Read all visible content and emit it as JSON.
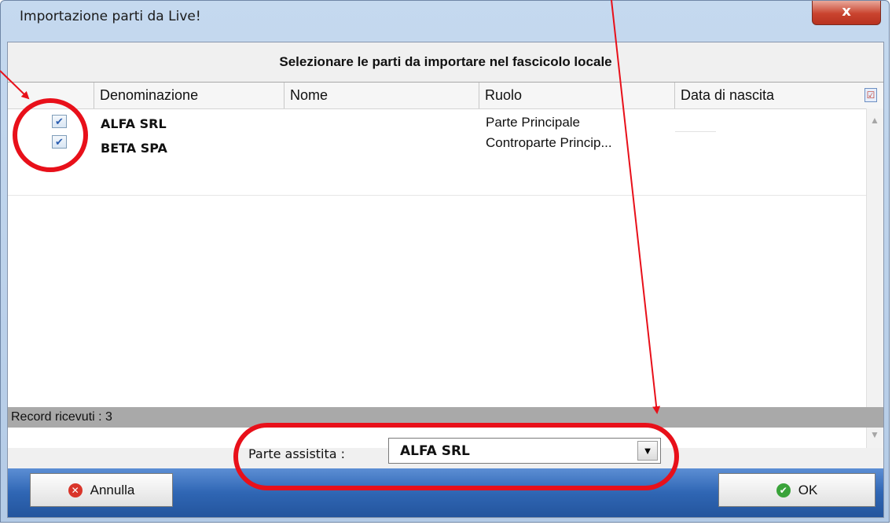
{
  "window": {
    "title": "Importazione parti da Live!",
    "close_glyph": "x"
  },
  "header": {
    "title": "Selezionare le parti da importare nel fascicolo locale"
  },
  "grid": {
    "columns": [
      "Denominazione",
      "Nome",
      "Ruolo",
      "Data di nascita"
    ],
    "rows": [
      {
        "checked": true,
        "denominazione": "ALFA SRL",
        "nome": "",
        "ruolo": "Parte Principale",
        "data_di_nascita": ""
      },
      {
        "checked": true,
        "denominazione": "BETA SPA",
        "nome": "",
        "ruolo": "Controparte Princip...",
        "data_di_nascita": ""
      }
    ],
    "check_glyph": "✔",
    "column_chooser_icon": "column-chooser-icon",
    "scroll_up_glyph": "▲",
    "scroll_down_glyph": "▼"
  },
  "status": {
    "text": "Record ricevuti : 3"
  },
  "parte_assistita": {
    "label": "Parte assistita :",
    "value": "ALFA SRL",
    "dropdown_glyph": "▼"
  },
  "buttons": {
    "cancel": {
      "label": "Annulla",
      "icon": "cancel-icon",
      "glyph": "✕"
    },
    "ok": {
      "label": "OK",
      "icon": "check-icon",
      "glyph": "✔"
    }
  },
  "colors": {
    "annotation": "#e8101a",
    "footer_blue": "#2f66b4",
    "cancel_red": "#d9352a",
    "ok_green": "#3aa33a"
  }
}
